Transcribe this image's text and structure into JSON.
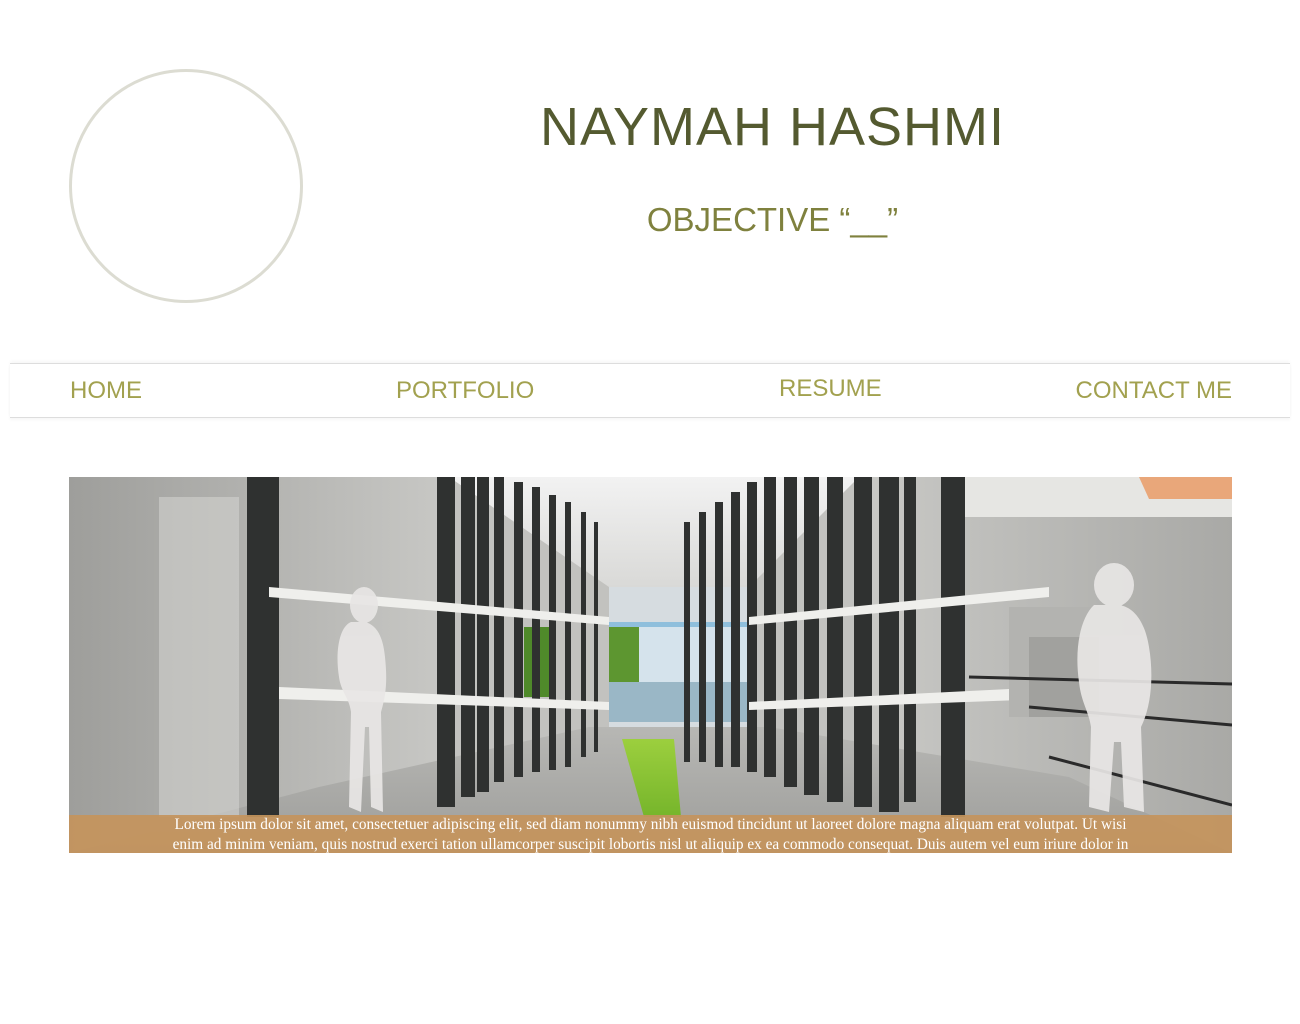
{
  "header": {
    "name": "NAYMAH HASHMI",
    "objective": "OBJECTIVE “__”"
  },
  "nav": {
    "items": [
      {
        "label": "HOME"
      },
      {
        "label": "PORTFOLIO"
      },
      {
        "label": "RESUME"
      },
      {
        "label": "CONTACT ME"
      }
    ]
  },
  "hero": {
    "caption_line1": "Lorem ipsum dolor sit amet, consectetuer adipiscing elit, sed diam nonummy nibh euismod tincidunt ut laoreet dolore magna aliquam erat volutpat. Ut wisi",
    "caption_line2": "enim ad minim veniam, quis nostrud exerci tation ullamcorper suscipit lobortis nisl ut aliquip ex ea commodo consequat. Duis autem vel eum iriure dolor in"
  },
  "colors": {
    "name": "#545a30",
    "objective": "#7f813e",
    "nav_text": "#a2a14f",
    "caption_bg": "#c4945c",
    "avatar_border": "#dcdcd2"
  }
}
